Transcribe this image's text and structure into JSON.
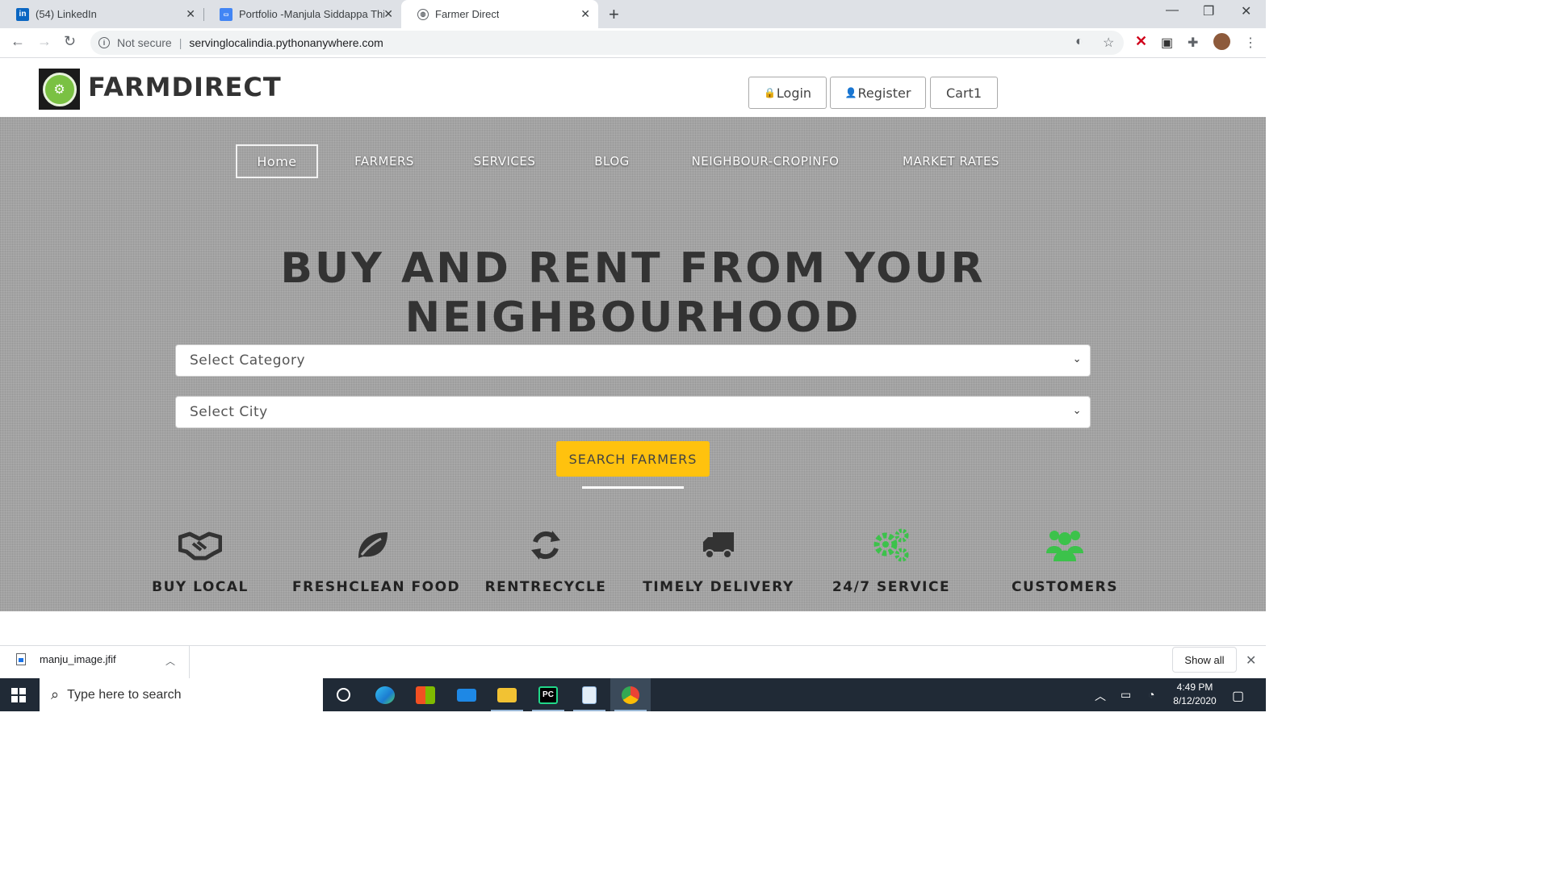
{
  "browser": {
    "tabs": [
      {
        "title": "(54) LinkedIn",
        "icon": "linkedin-icon"
      },
      {
        "title": "Portfolio -Manjula Siddappa Thimmappa",
        "icon": "portfolio-icon"
      },
      {
        "title": "Farmer Direct",
        "icon": "globe-icon"
      }
    ],
    "security_label": "Not secure",
    "url": "servinglocalindia.pythonanywhere.com"
  },
  "site": {
    "brand": "FARMDIRECT",
    "header_buttons": {
      "login": "Login",
      "register": "Register",
      "cart": "Cart1"
    },
    "nav": [
      "Home",
      "FARMERS",
      "SERVICES",
      "BLOG",
      "NEIGHBOUR-CROPINFO",
      "MARKET RATES"
    ],
    "hero": {
      "title_line1": "BUY AND RENT FROM YOUR",
      "title_line2": "NEIGHBOURHOOD",
      "category_select": "Select Category",
      "city_select": "Select City",
      "search_button": "SEARCH FARMERS"
    },
    "features": [
      {
        "label": "BUY LOCAL",
        "icon": "handshake-icon"
      },
      {
        "label": "FRESHCLEAN FOOD",
        "icon": "leaf-icon"
      },
      {
        "label": "RENTRECYCLE",
        "icon": "recycle-icon"
      },
      {
        "label": "TIMELY DELIVERY",
        "icon": "truck-icon"
      },
      {
        "label": "24/7 SERVICE",
        "icon": "gears-icon"
      },
      {
        "label": "CUSTOMERS",
        "icon": "users-icon"
      }
    ],
    "colors": {
      "accent_yellow": "#ffc20e",
      "hero_gray": "#a3a3a3",
      "green_icons": "#3cc24b"
    }
  },
  "downloads": {
    "file": "manju_image.jfif",
    "show_all": "Show all"
  },
  "taskbar": {
    "search_placeholder": "Type here to search",
    "time": "4:49 PM",
    "date": "8/12/2020"
  }
}
